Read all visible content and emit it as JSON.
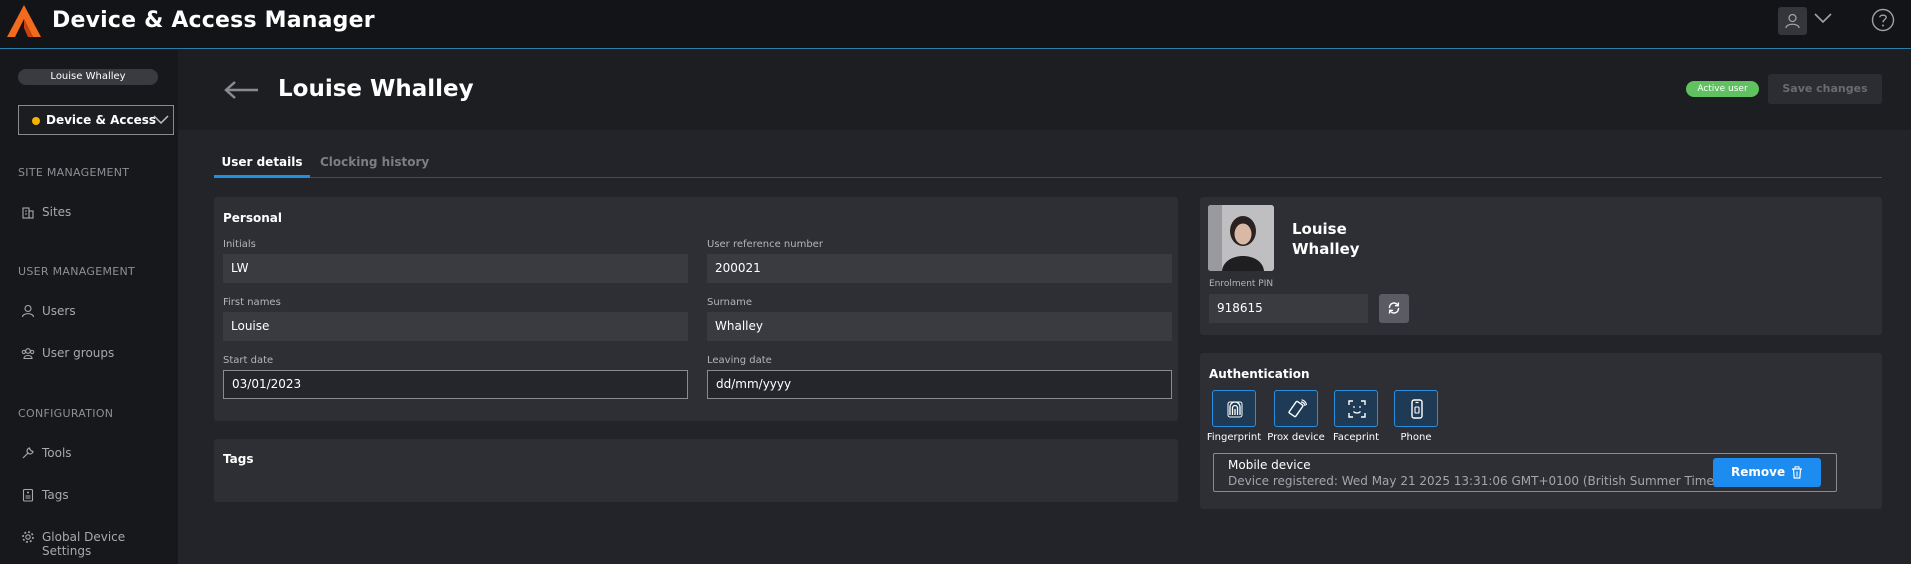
{
  "app": {
    "title": "Device & Access Manager",
    "accent_color": "#1f8fe0",
    "logo_colors": [
      "#f26b1d",
      "#e34a12"
    ]
  },
  "header": {
    "user_icon": "user-icon",
    "menu_icon": "chevron-down-icon",
    "help_icon": "help-circle-icon"
  },
  "sidebar": {
    "current_user": "Louise Whalley",
    "app_selector": {
      "label": "Device & Access",
      "status_color": "#f5b400"
    },
    "sections": [
      {
        "title": "SITE MANAGEMENT",
        "items": [
          {
            "label": "Sites",
            "icon": "building-icon"
          }
        ]
      },
      {
        "title": "USER MANAGEMENT",
        "items": [
          {
            "label": "Users",
            "icon": "user-icon"
          },
          {
            "label": "User groups",
            "icon": "user-group-icon"
          }
        ]
      },
      {
        "title": "CONFIGURATION",
        "items": [
          {
            "label": "Tools",
            "icon": "wrench-icon"
          },
          {
            "label": "Tags",
            "icon": "tag-icon"
          },
          {
            "label": "Global Device Settings",
            "icon": "gear-icon"
          }
        ]
      }
    ]
  },
  "page": {
    "title": "Louise Whalley",
    "status_badge": "Active user",
    "save_label": "Save changes"
  },
  "tabs": [
    {
      "label": "User details",
      "active": true
    },
    {
      "label": "Clocking history",
      "active": false
    }
  ],
  "personal": {
    "title": "Personal",
    "initials": {
      "label": "Initials",
      "value": "LW"
    },
    "reference": {
      "label": "User reference number",
      "value": "200021"
    },
    "first_names": {
      "label": "First names",
      "value": "Louise"
    },
    "surname": {
      "label": "Surname",
      "value": "Whalley"
    },
    "start_date": {
      "label": "Start date",
      "value": "03/01/2023"
    },
    "leaving_date": {
      "label": "Leaving date",
      "placeholder": "dd/mm/yyyy"
    }
  },
  "tags": {
    "title": "Tags"
  },
  "profile": {
    "first_name": "Louise",
    "last_name": "Whalley",
    "pin_label": "Enrolment PIN",
    "pin_value": "918615"
  },
  "authentication": {
    "title": "Authentication",
    "methods": [
      {
        "label": "Fingerprint",
        "icon": "fingerprint-icon"
      },
      {
        "label": "Prox device",
        "icon": "prox-card-icon"
      },
      {
        "label": "Faceprint",
        "icon": "face-scan-icon"
      },
      {
        "label": "Phone",
        "icon": "phone-icon"
      }
    ],
    "device": {
      "name": "Mobile device",
      "info": "Device registered: Wed May 21 2025 13:31:06 GMT+0100 (British Summer Time)",
      "remove_label": "Remove"
    }
  }
}
